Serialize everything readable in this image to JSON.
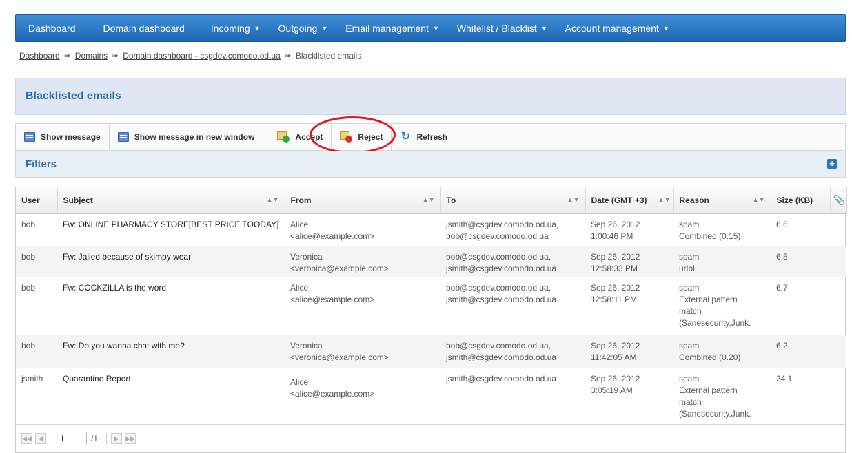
{
  "nav": {
    "items": [
      {
        "label": "Dashboard",
        "dropdown": false
      },
      {
        "label": "Domain dashboard",
        "dropdown": false
      },
      {
        "label": "Incoming",
        "dropdown": true
      },
      {
        "label": "Outgoing",
        "dropdown": true
      },
      {
        "label": "Email management",
        "dropdown": true
      },
      {
        "label": "Whitelist / Blacklist",
        "dropdown": true
      },
      {
        "label": "Account management",
        "dropdown": true
      }
    ]
  },
  "breadcrumb": {
    "items": [
      "Dashboard",
      "Domains",
      "Domain dashboard - csgdev.comodo.od.ua"
    ],
    "current": "Blacklisted emails"
  },
  "page_title": "Blacklisted emails",
  "toolbar": {
    "show_message": "Show message",
    "show_new_window": "Show message in new window",
    "accept": "Accept",
    "reject": "Reject",
    "refresh": "Refresh"
  },
  "filters": {
    "label": "Filters",
    "expand_icon": "plus-icon"
  },
  "table": {
    "columns": [
      "User",
      "Subject",
      "From",
      "To",
      "Date (GMT +3)",
      "Reason",
      "Size (KB)"
    ],
    "attachment_icon": "paperclip-icon",
    "rows": [
      {
        "user": "bob",
        "subject": "Fw: ONLINE PHARMACY STORE[BEST PRICE TOODAY]",
        "from_name": "Alice",
        "from_email": "<alice@example.com>",
        "to1": "jsmith@csgdev.comodo.od.ua,",
        "to2": "bob@csgdev.comodo.od.ua",
        "date": "Sep 26, 2012",
        "time": "1:00:46 PM",
        "reason1": "spam",
        "reason2": "Combined (0.15)",
        "reason3": "",
        "reason4": "",
        "size": "6.6"
      },
      {
        "user": "bob",
        "subject": "Fw: Jailed because of skimpy wear",
        "from_name": "Veronica",
        "from_email": "<veronica@example.com>",
        "to1": "bob@csgdev.comodo.od.ua,",
        "to2": "jsmith@csgdev.comodo.od.ua",
        "date": "Sep 26, 2012",
        "time": "12:58:33 PM",
        "reason1": "spam",
        "reason2": "urlbl",
        "reason3": "",
        "reason4": "",
        "size": "6.5"
      },
      {
        "user": "bob",
        "subject": "Fw: COCKZILLA is the word",
        "from_name": "Alice",
        "from_email": "<alice@example.com>",
        "to1": "bob@csgdev.comodo.od.ua,",
        "to2": "jsmith@csgdev.comodo.od.ua",
        "date": "Sep 26, 2012",
        "time": "12:58:11 PM",
        "reason1": "spam",
        "reason2": "External pattern",
        "reason3": "match",
        "reason4": "(Sanesecurity.Junk.",
        "size": "6.7"
      },
      {
        "user": "bob",
        "subject": "Fw: Do you wanna chat with me?",
        "from_name": "Veronica",
        "from_email": "<veronica@example.com>",
        "to1": "bob@csgdev.comodo.od.ua,",
        "to2": "jsmith@csgdev.comodo.od.ua",
        "date": "Sep 26, 2012",
        "time": "11:42:05 AM",
        "reason1": "spam",
        "reason2": "Combined (0.20)",
        "reason3": "",
        "reason4": "",
        "size": "6.2"
      },
      {
        "user": "jsmith",
        "subject": "Quarantine Report",
        "from_name": "Alice",
        "from_email": "<alice@example.com>",
        "to1": "jsmith@csgdev.comodo.od.ua",
        "to2": "",
        "date": "Sep 26, 2012",
        "time": "3:05:19 AM",
        "reason1": "spam",
        "reason2": "External pattern",
        "reason3": "match",
        "reason4": "(Sanesecurity.Junk.",
        "size": "24.1"
      }
    ]
  },
  "pager": {
    "page": "1",
    "total": "/1"
  }
}
